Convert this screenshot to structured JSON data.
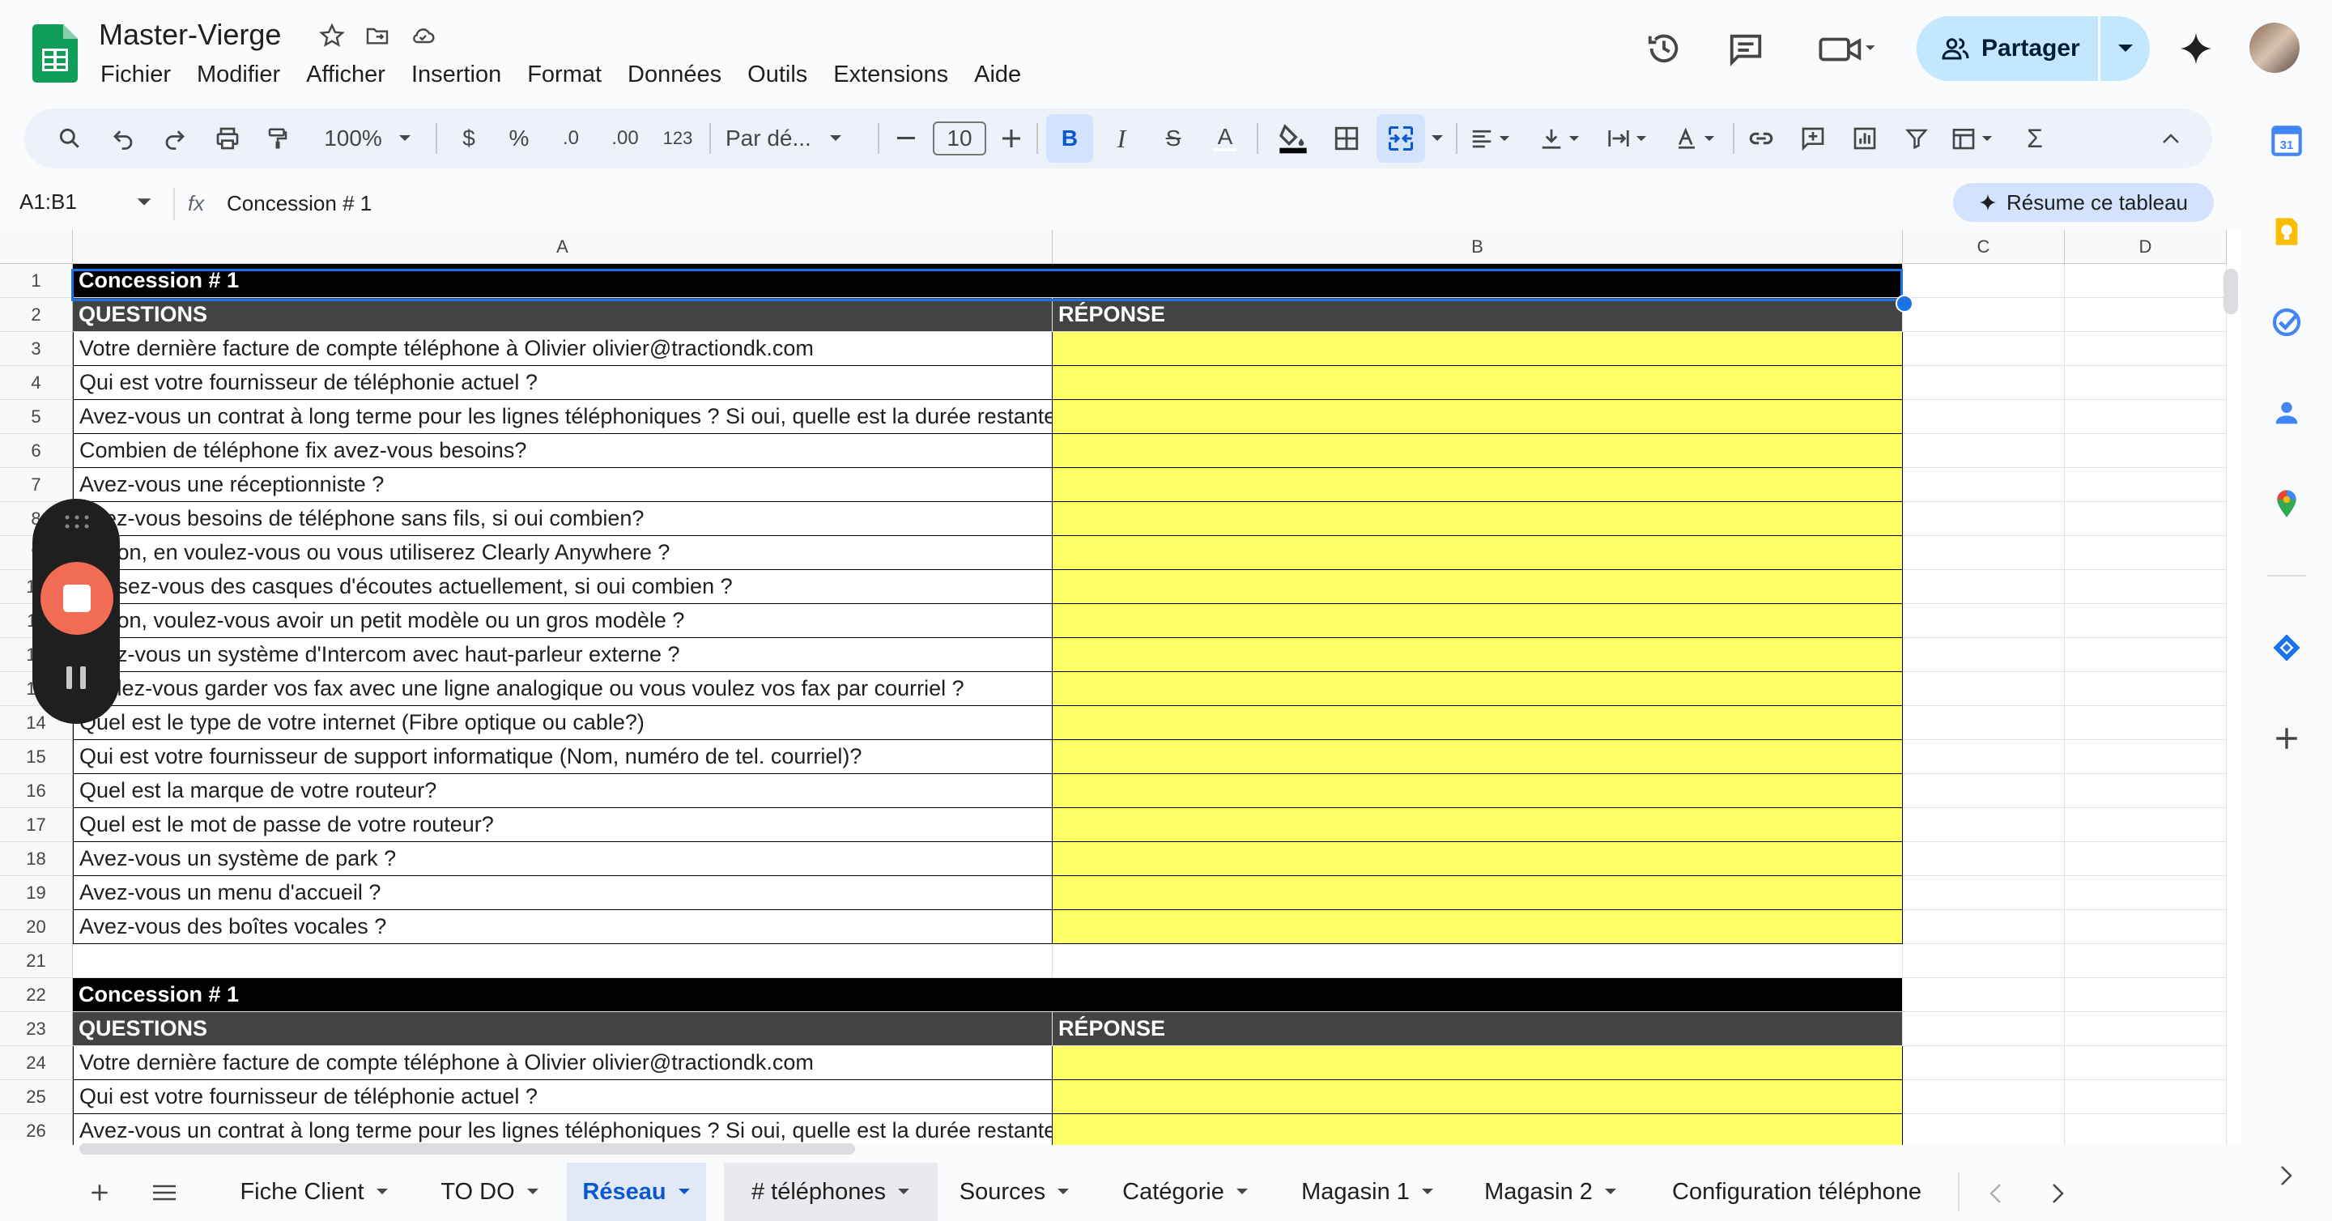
{
  "app": {
    "doc_title": "Master-Vierge",
    "menu": [
      "Fichier",
      "Modifier",
      "Afficher",
      "Insertion",
      "Format",
      "Données",
      "Outils",
      "Extensions",
      "Aide"
    ],
    "share_label": "Partager"
  },
  "toolbar": {
    "zoom": "100%",
    "currency": "$",
    "percent": "%",
    "dec_less": ".0",
    "dec_more": ".00",
    "format_123": "123",
    "font": "Par dé...",
    "font_size": "10",
    "bold": "B",
    "italic": "I",
    "strike": "S",
    "text_color": "A",
    "sum": "Σ"
  },
  "formula_bar": {
    "name_box": "A1:B1",
    "fx": "fx",
    "content": "Concession # 1",
    "summarize_label": "Résume ce tableau"
  },
  "grid": {
    "columns": [
      "A",
      "B",
      "C",
      "D"
    ],
    "rows": [
      {
        "n": "1",
        "a": "Concession # 1",
        "b": "",
        "style": "black"
      },
      {
        "n": "2",
        "a": "QUESTIONS",
        "b": "RÉPONSE",
        "style": "dark"
      },
      {
        "n": "3",
        "a": "Votre dernière facture de compte téléphone à Olivier olivier@tractiondk.com",
        "b": "",
        "style": "q"
      },
      {
        "n": "4",
        "a": "Qui est votre fournisseur de téléphonie actuel ?",
        "b": "",
        "style": "q"
      },
      {
        "n": "5",
        "a": "Avez-vous un contrat à long terme pour les lignes téléphoniques ? Si oui, quelle est la durée restante",
        "b": "",
        "style": "q"
      },
      {
        "n": "6",
        "a": "Combien de téléphone fix avez-vous besoins?",
        "b": "",
        "style": "q"
      },
      {
        "n": "7",
        "a": "Avez-vous une réceptionniste ?",
        "b": "",
        "style": "q"
      },
      {
        "n": "8",
        "a": "Avez-vous besoins de téléphone sans fils, si oui combien?",
        "b": "",
        "style": "q"
      },
      {
        "n": "9",
        "a": "Si non, en voulez-vous ou vous utiliserez Clearly Anywhere ?",
        "b": "",
        "style": "q"
      },
      {
        "n": "10",
        "a": "Possez-vous des casques d'écoutes actuellement, si oui combien ?",
        "b": "",
        "style": "q"
      },
      {
        "n": "11",
        "a": "Si non, voulez-vous avoir un petit modèle ou un gros modèle ?",
        "b": "",
        "style": "q"
      },
      {
        "n": "12",
        "a": "Avez-vous un système d'Intercom avec haut-parleur externe ?",
        "b": "",
        "style": "q"
      },
      {
        "n": "13",
        "a": "Voulez-vous garder vos fax avec une ligne analogique ou vous voulez vos fax par courriel ?",
        "b": "",
        "style": "q"
      },
      {
        "n": "14",
        "a": "Quel est le type de votre internet (Fibre optique ou cable?)",
        "b": "",
        "style": "q"
      },
      {
        "n": "15",
        "a": "Qui est votre fournisseur de support informatique (Nom, numéro de tel. courriel)?",
        "b": "",
        "style": "q"
      },
      {
        "n": "16",
        "a": "Quel est la marque de votre routeur?",
        "b": "",
        "style": "q"
      },
      {
        "n": "17",
        "a": "Quel est le mot de passe de votre routeur?",
        "b": "",
        "style": "q"
      },
      {
        "n": "18",
        "a": "Avez-vous un système de park ?",
        "b": "",
        "style": "q"
      },
      {
        "n": "19",
        "a": "Avez-vous un menu d'accueil ?",
        "b": "",
        "style": "q"
      },
      {
        "n": "20",
        "a": "Avez-vous des boîtes vocales ?",
        "b": "",
        "style": "q"
      },
      {
        "n": "21",
        "a": "",
        "b": "",
        "style": "empty"
      },
      {
        "n": "22",
        "a": "Concession # 1",
        "b": "",
        "style": "black"
      },
      {
        "n": "23",
        "a": "QUESTIONS",
        "b": "RÉPONSE",
        "style": "dark"
      },
      {
        "n": "24",
        "a": "Votre dernière facture de compte téléphone à Olivier olivier@tractiondk.com",
        "b": "",
        "style": "q"
      },
      {
        "n": "25",
        "a": "Qui est votre fournisseur de téléphonie actuel ?",
        "b": "",
        "style": "q"
      },
      {
        "n": "26",
        "a": "Avez-vous un contrat à long terme pour les lignes téléphoniques ? Si oui, quelle est la durée restante",
        "b": "",
        "style": "q"
      }
    ]
  },
  "sheets": {
    "tabs": [
      "Fiche Client",
      "TO DO",
      "Réseau",
      "# téléphones",
      "Sources",
      "Catégorie",
      "Magasin 1",
      "Magasin 2",
      "Configuration téléphone"
    ],
    "active": "Réseau"
  },
  "colors": {
    "header_black": "#000000",
    "header_dark": "#434343",
    "answer_yellow": "#ffff66",
    "share_bg": "#c2e7ff",
    "recorder_stop": "#f26b55"
  }
}
